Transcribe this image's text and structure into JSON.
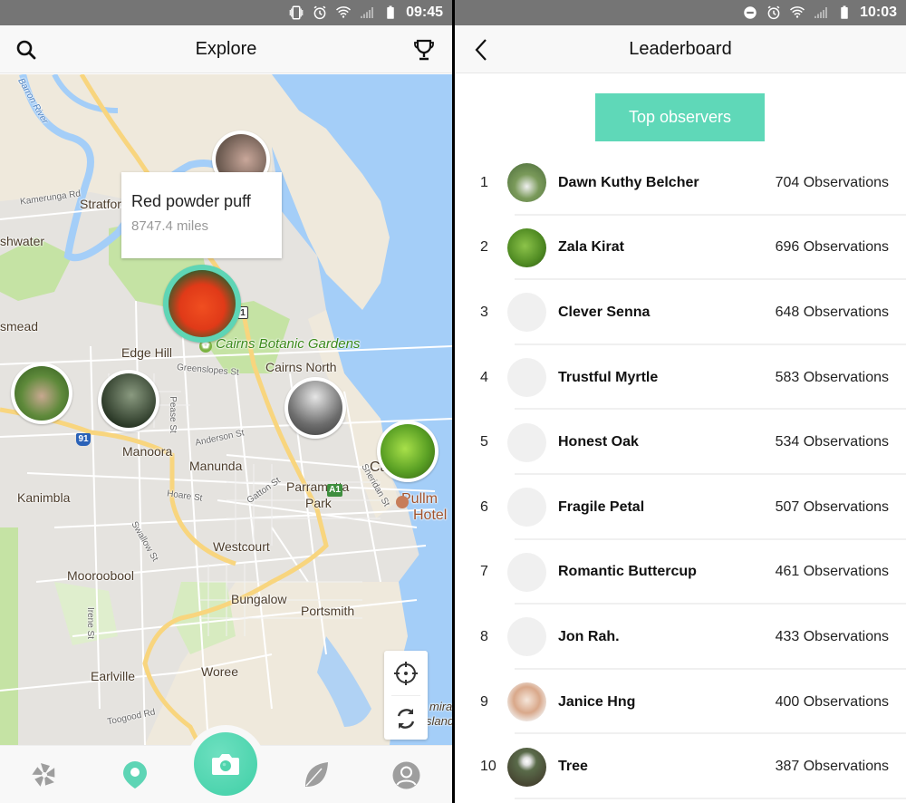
{
  "explore": {
    "status_bar": {
      "time": "09:45",
      "icons": [
        "vibrate-icon",
        "alarm-icon",
        "wifi-icon",
        "signal-icon",
        "battery-icon"
      ]
    },
    "header": {
      "title": "Explore",
      "left_icon": "search-icon",
      "right_icon": "trophy-icon"
    },
    "popup": {
      "name": "Red powder puff",
      "distance": "8747.4 miles"
    },
    "map_labels": {
      "barron_river": "Barron River",
      "kamerunga_rd": "Kamerunga Rd",
      "stratford": "Stratfor",
      "freshwater": "shwater",
      "brinsmead": "smead",
      "edge_hill": "Edge Hill",
      "botanic_gardens": "Cairns Botanic Gardens",
      "cairns_north": "Cairns North",
      "greenslopes_st": "Greenslopes St",
      "pease_st": "Pease St",
      "manoora": "Manoora",
      "anderson_st": "Anderson St",
      "manunda": "Manunda",
      "kanimbla": "Kanimbla",
      "hoare_st": "Hoare St",
      "gatton_st": "Gatton St",
      "sheridan_st": "Sheridan St",
      "cairns": "Ca",
      "pullman_hotel_1": "Pullm",
      "pullman_hotel_2": "Hotel",
      "parramatta_park_1": "Parramatta",
      "parramatta_park_2": "Park",
      "swallow_st": "Swallow St",
      "westcourt": "Westcourt",
      "mooroobool": "Mooroobool",
      "bungalow": "Bungalow",
      "portsmith": "Portsmith",
      "irene_st": "Irene St",
      "earlville": "Earlville",
      "woree": "Woree",
      "toogood_rd": "Toogood Rd",
      "admiralty_island_1": "mira",
      "admiralty_island_2": "sland"
    },
    "route_shields": {
      "route_1": "1",
      "route_91": "91",
      "route_a1": "A1"
    },
    "markers": [
      {
        "name": "marker-pink-flower",
        "active": false
      },
      {
        "name": "marker-red-powder-puff",
        "active": true
      },
      {
        "name": "marker-ground-cover",
        "active": false
      },
      {
        "name": "marker-dark-leaves",
        "active": false
      },
      {
        "name": "marker-white-blossoms",
        "active": false
      },
      {
        "name": "marker-green-leaves",
        "active": false
      }
    ],
    "map_controls": [
      "locate-icon",
      "refresh-icon"
    ],
    "bottom_nav": [
      {
        "id": "pinwheel",
        "icon": "pinwheel-icon",
        "active": false
      },
      {
        "id": "explore",
        "icon": "location-pin-icon",
        "active": true
      },
      {
        "id": "camera",
        "icon": "camera-icon",
        "active": false
      },
      {
        "id": "leaf",
        "icon": "leaf-icon",
        "active": false
      },
      {
        "id": "profile",
        "icon": "profile-icon",
        "active": false
      }
    ],
    "colors": {
      "accent": "#5ed5b5",
      "water": "#a4cef8",
      "land": "#e5e3df",
      "park": "#c5e3a4"
    }
  },
  "leaderboard": {
    "status_bar": {
      "time": "10:03",
      "icons": [
        "do-not-disturb-icon",
        "alarm-icon",
        "wifi-icon",
        "signal-icon",
        "battery-icon"
      ]
    },
    "header": {
      "title": "Leaderboard",
      "left_icon": "back-arrow-icon"
    },
    "tab": {
      "label": "Top observers"
    },
    "entries": [
      {
        "rank": "1",
        "name": "Dawn Kuthy Belcher",
        "count": "704 Observations",
        "has_photo": true
      },
      {
        "rank": "2",
        "name": "Zala Kirat",
        "count": "696 Observations",
        "has_photo": true
      },
      {
        "rank": "3",
        "name": "Clever Senna",
        "count": "648 Observations",
        "has_photo": false
      },
      {
        "rank": "4",
        "name": "Trustful Myrtle",
        "count": "583 Observations",
        "has_photo": false
      },
      {
        "rank": "5",
        "name": "Honest Oak",
        "count": "534 Observations",
        "has_photo": false
      },
      {
        "rank": "6",
        "name": "Fragile Petal",
        "count": "507 Observations",
        "has_photo": false
      },
      {
        "rank": "7",
        "name": "Romantic Buttercup",
        "count": "461 Observations",
        "has_photo": false
      },
      {
        "rank": "8",
        "name": "Jon Rah.",
        "count": "433 Observations",
        "has_photo": false
      },
      {
        "rank": "9",
        "name": "Janice Hng",
        "count": "400 Observations",
        "has_photo": true
      },
      {
        "rank": "10",
        "name": "Tree",
        "count": "387 Observations",
        "has_photo": true
      }
    ],
    "colors": {
      "tab_bg": "#5fd8b8",
      "placeholder_avatar": "#f0f0f0"
    }
  }
}
